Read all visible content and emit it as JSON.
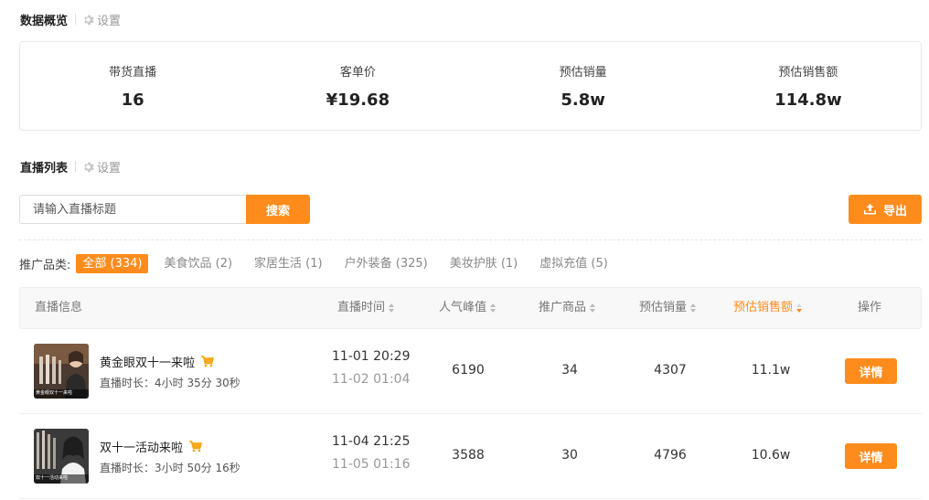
{
  "overview": {
    "title": "数据概览",
    "settings_label": "设置",
    "stats": [
      {
        "label": "带货直播",
        "value": "16"
      },
      {
        "label": "客单价",
        "value": "¥19.68"
      },
      {
        "label": "预估销量",
        "value": "5.8w"
      },
      {
        "label": "预估销售额",
        "value": "114.8w"
      }
    ]
  },
  "live_list": {
    "title": "直播列表",
    "settings_label": "设置"
  },
  "search": {
    "placeholder": "请输入直播标题",
    "button_label": "搜索"
  },
  "export": {
    "label": "导出"
  },
  "filters": {
    "label": "推广品类:",
    "tabs": [
      {
        "label": "全部 (334)",
        "active": true
      },
      {
        "label": "美食饮品 (2)",
        "active": false
      },
      {
        "label": "家居生活 (1)",
        "active": false
      },
      {
        "label": "户外装备 (325)",
        "active": false
      },
      {
        "label": "美妆护肤 (1)",
        "active": false
      },
      {
        "label": "虚拟充值 (5)",
        "active": false
      }
    ]
  },
  "table": {
    "headers": {
      "info": "直播信息",
      "time": "直播时间",
      "peak": "人气峰值",
      "products": "推广商品",
      "sales": "预估销量",
      "revenue": "预估销售额",
      "action": "操作"
    },
    "sorted_column": "revenue",
    "rows": [
      {
        "title": "黄金眼双十一来啦",
        "thumb_caption": "黄金眼双十一来啦",
        "duration": "直播时长：4小时 35分 30秒",
        "start": "11-01 20:29",
        "end": "11-02 01:04",
        "peak": "6190",
        "products": "34",
        "sales": "4307",
        "revenue": "11.1w",
        "action": "详情"
      },
      {
        "title": "双十一活动来啦",
        "thumb_caption": "双十一活动来啦",
        "duration": "直播时长：3小时 50分 16秒",
        "start": "11-04 21:25",
        "end": "11-05 01:16",
        "peak": "3588",
        "products": "30",
        "sales": "4796",
        "revenue": "10.6w",
        "action": "详情"
      }
    ]
  },
  "colors": {
    "accent": "#fd8c1c",
    "border": "#e8e8e8",
    "header_bg": "#f8f8f8"
  }
}
